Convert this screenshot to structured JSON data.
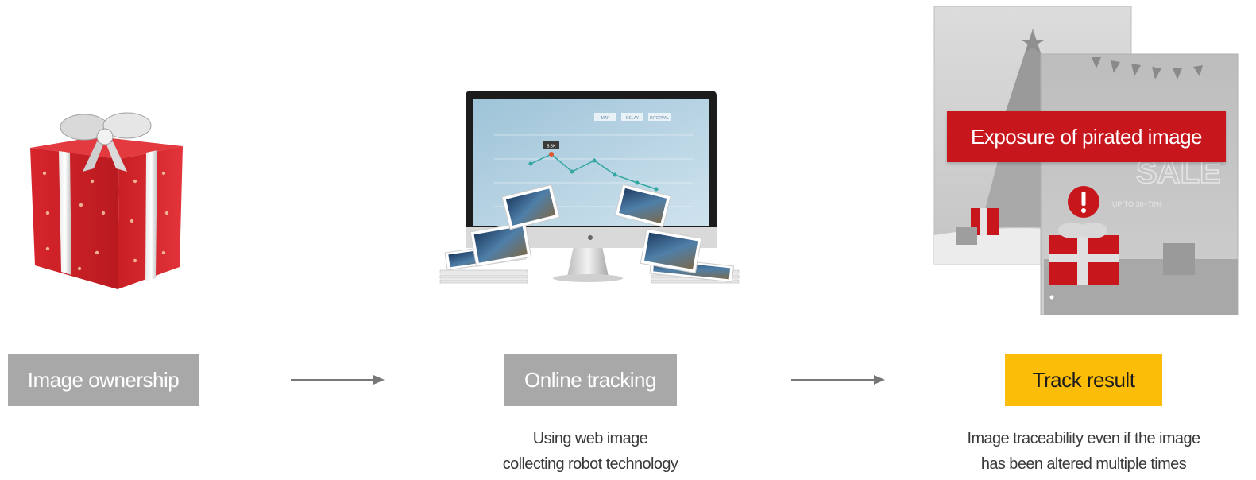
{
  "steps": [
    {
      "label": "Image ownership",
      "caption_lines": []
    },
    {
      "label": "Online tracking",
      "caption_lines": [
        "Using web image",
        "collecting robot technology"
      ]
    },
    {
      "label": "Track result",
      "caption_lines": [
        "Image traceability even if the image",
        "has been altered multiple times"
      ]
    }
  ],
  "result_banner": "Exposure of pirated image",
  "poster_text": {
    "sale": "SALE",
    "discount": "UP TO 30~70%"
  },
  "monitor_buttons": [
    "MAP",
    "DELAY",
    "INTERVAL"
  ],
  "chart_point_label": "5.3K",
  "colors": {
    "gray_box": "#a8a8a8",
    "accent_yellow": "#fbbd08",
    "alert_red": "#c8161d",
    "arrow": "#777777"
  }
}
